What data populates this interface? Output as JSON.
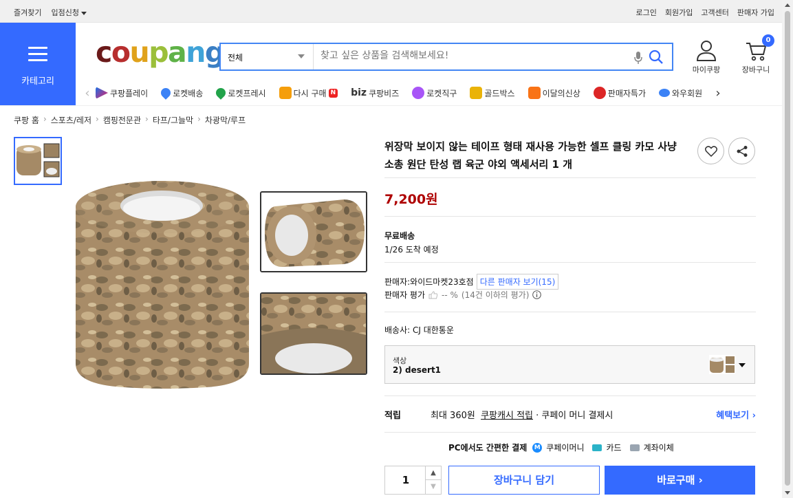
{
  "topbar": {
    "bookmarks": "즐겨찾기",
    "apply": "입점신청",
    "login": "로그인",
    "signup": "회원가입",
    "support": "고객센터",
    "seller_signup": "판매자 가입"
  },
  "category": {
    "label": "카테고리"
  },
  "logo": {
    "letters": [
      "c",
      "o",
      "u",
      "p",
      "a",
      "n",
      "g"
    ],
    "colors": [
      "#6b1a1a",
      "#b72e2e",
      "#e0a21b",
      "#9bbf3a",
      "#5fb248",
      "#3fa3d8",
      "#3b7fc4"
    ]
  },
  "search": {
    "category": "전체",
    "placeholder": "찾고 싶은 상품을 검색해보세요!"
  },
  "account": {
    "label": "마이쿠팡",
    "cart_label": "장바구니",
    "cart_count": "0"
  },
  "services": [
    {
      "label": "쿠팡플레이",
      "color": "#1a73e8"
    },
    {
      "label": "로켓배송",
      "color": "#3b82f6"
    },
    {
      "label": "로켓프레시",
      "color": "#22a34a"
    },
    {
      "label": "다시 구매",
      "color": "#f59e0b",
      "badge": "N"
    },
    {
      "label": "쿠팡비즈",
      "prefix": "biz",
      "color": "#333"
    },
    {
      "label": "로켓직구",
      "color": "#a855f7"
    },
    {
      "label": "골드박스",
      "color": "#eab308"
    },
    {
      "label": "이달의신상",
      "color": "#f97316"
    },
    {
      "label": "판매자특가",
      "color": "#dc2626"
    },
    {
      "label": "와우회원",
      "color": "#3b82f6"
    }
  ],
  "breadcrumb": [
    "쿠팡 홈",
    "스포츠/레저",
    "캠핑전문관",
    "타프/그늘막",
    "차광막/루프"
  ],
  "product": {
    "title": "위장막 보이지 않는 테이프 형태 재사용 가능한 셀프 클링 카모 사냥 소총 원단 탄성 랩 육군 야외 액세서리 1 개",
    "price": "7,200원",
    "shipping_type": "무료배송",
    "arrival": "1/26 도착 예정",
    "seller_label": "판매자:와이드마켓23호점",
    "other_seller": "다른 판매자 보기(15)",
    "rating_label": "판매자 평가",
    "rating_value": "-- %",
    "rating_note": "(14건 이하의 평가)",
    "carrier": "배송사:  CJ 대한통운",
    "option_label": "색상",
    "option_value": "2) desert1",
    "reward_title": "적립",
    "reward_text_pre": "최대 360원",
    "reward_link": "쿠팡캐시 적립",
    "reward_text_post": "· 쿠페이 머니 결제시",
    "reward_more": "혜택보기 ›",
    "pay_lead": "PC에서도 간편한 결제",
    "pay_money": "쿠페이머니",
    "pay_card": "카드",
    "pay_bank": "계좌이체",
    "quantity": "1",
    "add_cart": "장바구니 담기",
    "buy_now": "바로구매 ›"
  }
}
